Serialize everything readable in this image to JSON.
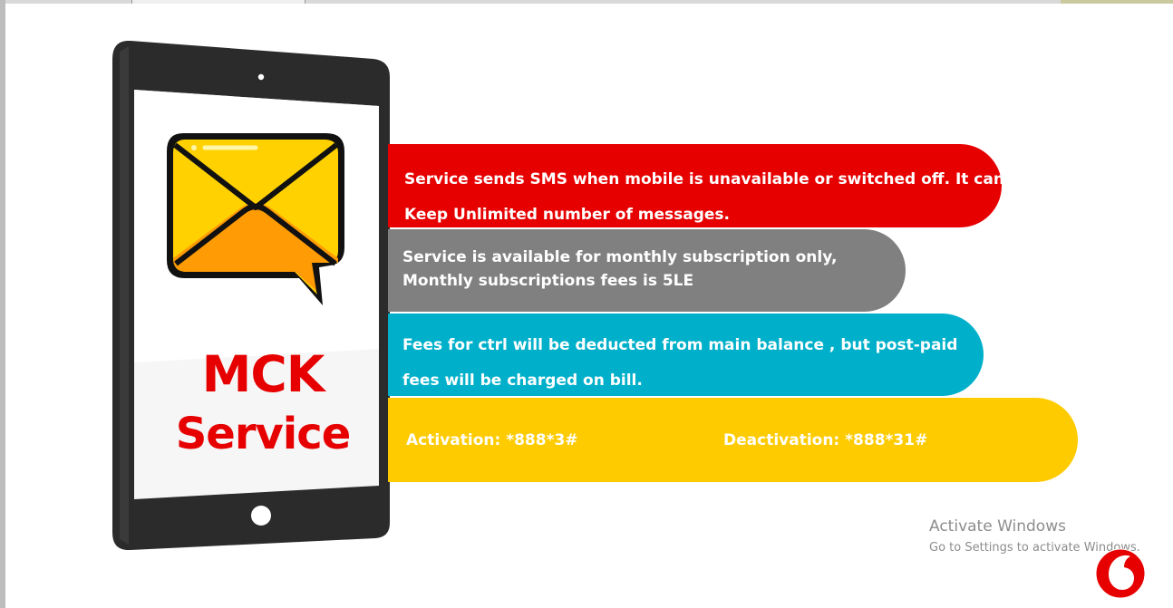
{
  "bands": {
    "red": {
      "line1": "Service sends SMS when mobile is unavailable or switched off. It can",
      "line2": "Keep Unlimited number of messages."
    },
    "gray": {
      "line1": "Service is available  for monthly subscription only,",
      "line2": "Monthly subscriptions fees is 5LE"
    },
    "cyan": {
      "line1": "Fees for ctrl will be deducted from main balance , but post-paid",
      "line2": "fees will be charged on bill."
    },
    "yellow": {
      "activation": "Activation: *888*3#",
      "deactivation": "Deactivation: *888*31#"
    }
  },
  "tablet": {
    "title_line1": "MCK",
    "title_line2": "Service",
    "icon": "envelope-chat-icon"
  },
  "watermark": {
    "line1": "Activate Windows",
    "line2": "Go to Settings to activate Windows."
  },
  "logo": {
    "icon": "vodafone-logo-icon"
  },
  "colors": {
    "red": "#e60000",
    "gray": "#808080",
    "cyan": "#00b0ca",
    "yellow": "#fecb00",
    "tablet_frame": "#2b2b2b"
  }
}
